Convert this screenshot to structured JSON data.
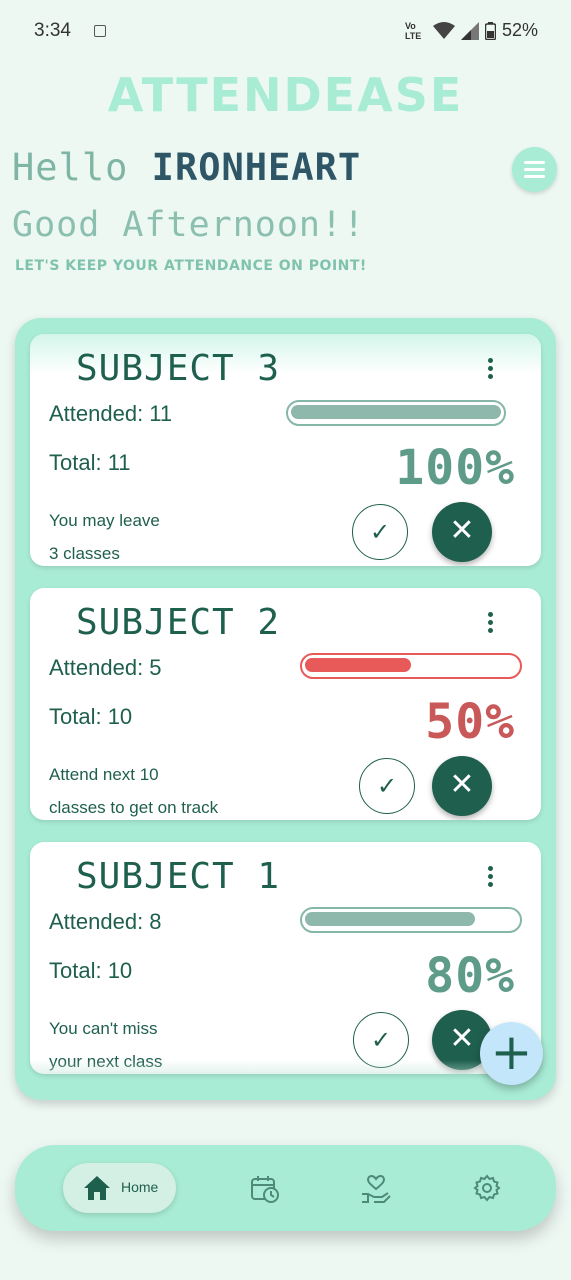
{
  "status_bar": {
    "time": "3:34",
    "network": "Vo LTE",
    "battery": "52%"
  },
  "header": {
    "app_title": "ATTENDEASE",
    "hello": "Hello",
    "user_name": "IRONHEART",
    "greeting": "Good Afternoon!!",
    "tagline": "LET'S KEEP YOUR ATTENDANCE ON POINT!"
  },
  "subjects": [
    {
      "title": "SUBJECT 3",
      "attended_label": "Attended: 11",
      "total_label": "Total: 11",
      "percent": "100%",
      "progress": 1.0,
      "status": "ok",
      "message_line1": "You may leave",
      "message_line2": "3 classes"
    },
    {
      "title": "SUBJECT 2",
      "attended_label": "Attended: 5",
      "total_label": "Total: 10",
      "percent": "50%",
      "progress": 0.5,
      "status": "low",
      "message_line1": "Attend next 10",
      "message_line2": "classes to get on track"
    },
    {
      "title": "SUBJECT 1",
      "attended_label": "Attended: 8",
      "total_label": "Total: 10",
      "percent": "80%",
      "progress": 0.8,
      "status": "ok",
      "message_line1": "You can't miss",
      "message_line2": "your next class"
    }
  ],
  "icons": {
    "check": "✓",
    "close": "✕",
    "add": "+"
  },
  "nav": {
    "home_label": "Home",
    "items": [
      "home-icon",
      "calendar-clock-icon",
      "heart-hand-icon",
      "settings-icon"
    ]
  },
  "colors": {
    "accent": "#a8ecd5",
    "primary": "#1f5f4e",
    "danger": "#e85a5a",
    "background": "#eef8f3"
  }
}
